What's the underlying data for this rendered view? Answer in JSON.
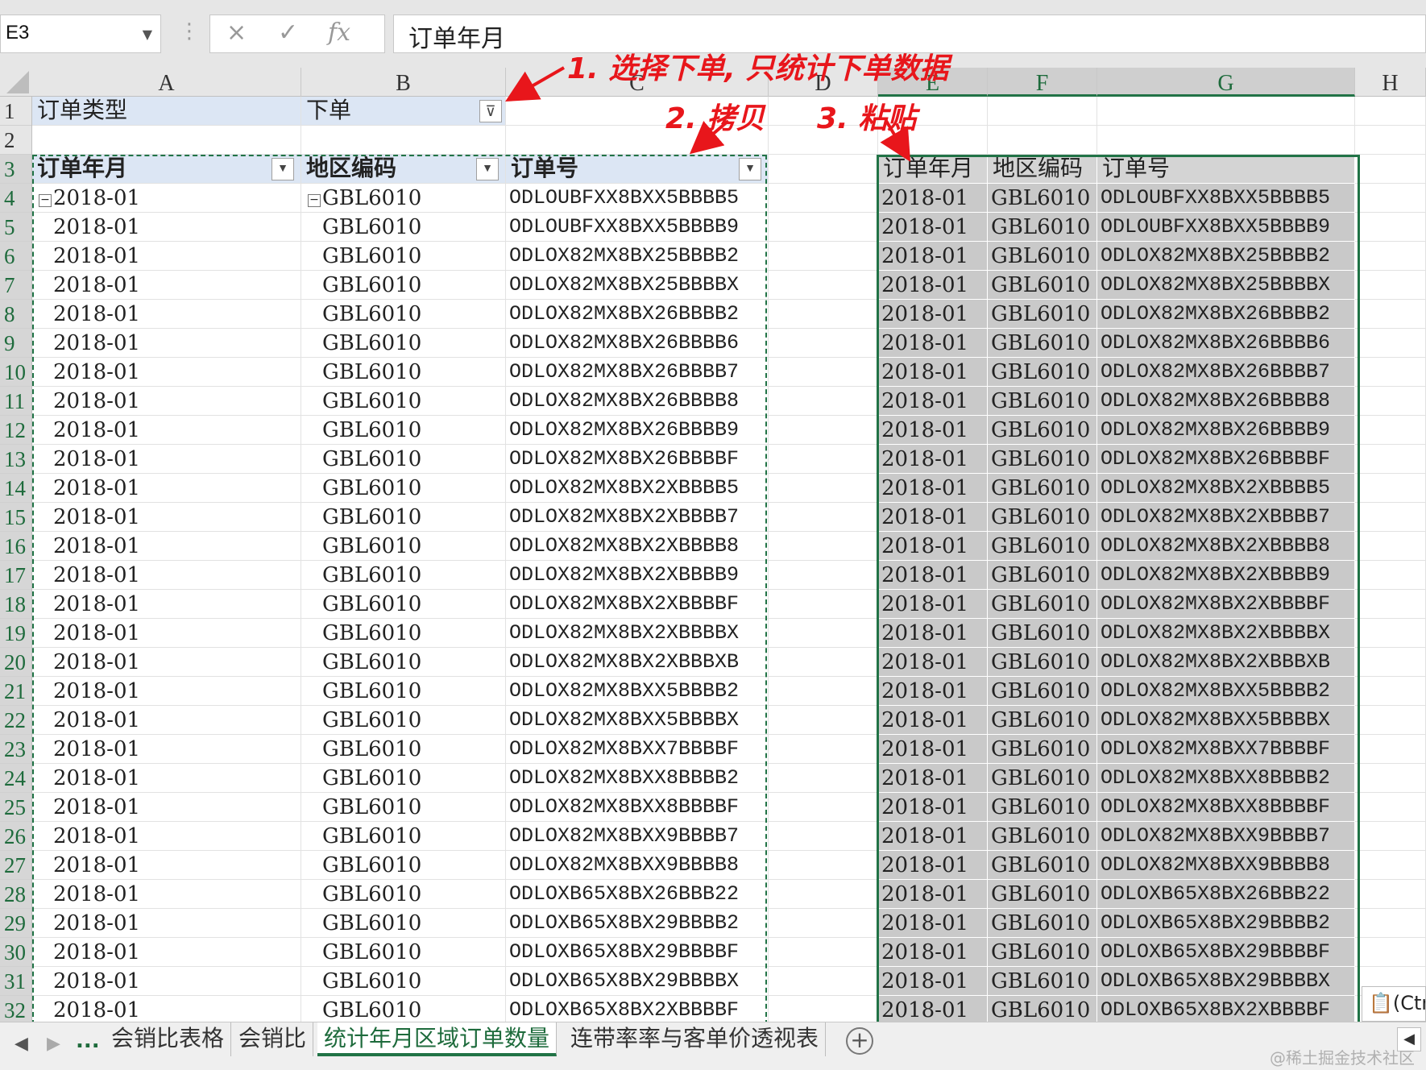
{
  "formula_bar": {
    "name_box": "E3",
    "cancel_icon": "×",
    "confirm_icon": "✓",
    "fx_label": "fx",
    "formula": "订单年月"
  },
  "columns": [
    "A",
    "B",
    "C",
    "D",
    "E",
    "F",
    "G",
    "H"
  ],
  "filter_row": {
    "label": "订单类型",
    "value": "下单"
  },
  "pivot_headers": [
    "订单年月",
    "地区编码",
    "订单号"
  ],
  "pasted_headers": [
    "订单年月",
    "地区编码",
    "订单号"
  ],
  "rows": [
    [
      "2018-01",
      "GBL6010",
      "ODLOUBFXX8BXX5BBBB5"
    ],
    [
      "2018-01",
      "GBL6010",
      "ODLOUBFXX8BXX5BBBB9"
    ],
    [
      "2018-01",
      "GBL6010",
      "ODLOX82MX8BX25BBBB2"
    ],
    [
      "2018-01",
      "GBL6010",
      "ODLOX82MX8BX25BBBBX"
    ],
    [
      "2018-01",
      "GBL6010",
      "ODLOX82MX8BX26BBBB2"
    ],
    [
      "2018-01",
      "GBL6010",
      "ODLOX82MX8BX26BBBB6"
    ],
    [
      "2018-01",
      "GBL6010",
      "ODLOX82MX8BX26BBBB7"
    ],
    [
      "2018-01",
      "GBL6010",
      "ODLOX82MX8BX26BBBB8"
    ],
    [
      "2018-01",
      "GBL6010",
      "ODLOX82MX8BX26BBBB9"
    ],
    [
      "2018-01",
      "GBL6010",
      "ODLOX82MX8BX26BBBBF"
    ],
    [
      "2018-01",
      "GBL6010",
      "ODLOX82MX8BX2XBBBB5"
    ],
    [
      "2018-01",
      "GBL6010",
      "ODLOX82MX8BX2XBBBB7"
    ],
    [
      "2018-01",
      "GBL6010",
      "ODLOX82MX8BX2XBBBB8"
    ],
    [
      "2018-01",
      "GBL6010",
      "ODLOX82MX8BX2XBBBB9"
    ],
    [
      "2018-01",
      "GBL6010",
      "ODLOX82MX8BX2XBBBBF"
    ],
    [
      "2018-01",
      "GBL6010",
      "ODLOX82MX8BX2XBBBBX"
    ],
    [
      "2018-01",
      "GBL6010",
      "ODLOX82MX8BX2XBBBXB"
    ],
    [
      "2018-01",
      "GBL6010",
      "ODLOX82MX8BXX5BBBB2"
    ],
    [
      "2018-01",
      "GBL6010",
      "ODLOX82MX8BXX5BBBBX"
    ],
    [
      "2018-01",
      "GBL6010",
      "ODLOX82MX8BXX7BBBBF"
    ],
    [
      "2018-01",
      "GBL6010",
      "ODLOX82MX8BXX8BBBB2"
    ],
    [
      "2018-01",
      "GBL6010",
      "ODLOX82MX8BXX8BBBBF"
    ],
    [
      "2018-01",
      "GBL6010",
      "ODLOX82MX8BXX9BBBB7"
    ],
    [
      "2018-01",
      "GBL6010",
      "ODLOX82MX8BXX9BBBB8"
    ],
    [
      "2018-01",
      "GBL6010",
      "ODLOXB65X8BX26BBB22"
    ],
    [
      "2018-01",
      "GBL6010",
      "ODLOXB65X8BX29BBBB2"
    ],
    [
      "2018-01",
      "GBL6010",
      "ODLOXB65X8BX29BBBBF"
    ],
    [
      "2018-01",
      "GBL6010",
      "ODLOXB65X8BX29BBBBX"
    ],
    [
      "2018-01",
      "GBL6010",
      "ODLOXB65X8BX2XBBBBF"
    ]
  ],
  "annotations": {
    "step1": "1. 选择下单, 只统计下单数据",
    "step2": "2. 拷贝",
    "step3": "3. 粘贴"
  },
  "paste_options_label": "(Ctrl)",
  "sheet_tabs": {
    "more": "...",
    "tabs": [
      "会销比表格",
      "会销比",
      "统计年月区域订单数量",
      "连带率率与客单价透视表"
    ],
    "active_index": 2
  },
  "watermark": "@稀土掘金技术社区",
  "colors": {
    "accent": "#217346",
    "annotation": "#e8161b",
    "pivot_header": "#dce6f4",
    "paste_fill": "#c9c9c9"
  }
}
